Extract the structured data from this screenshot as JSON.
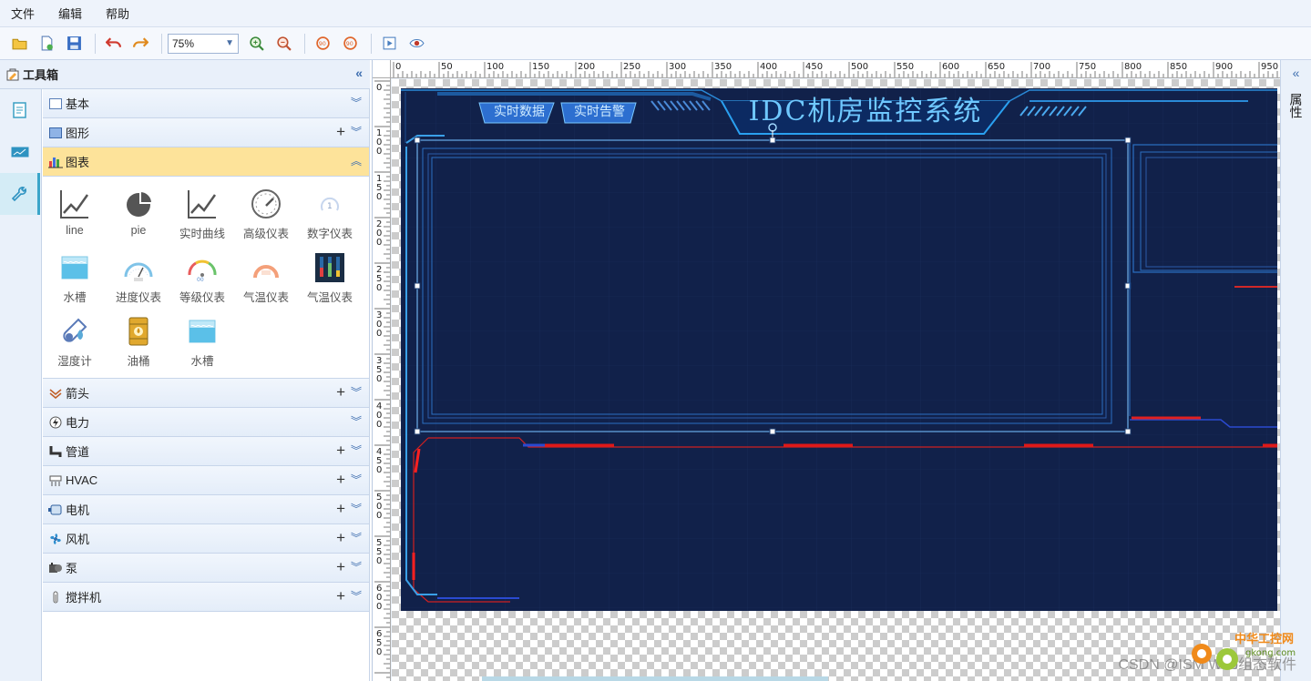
{
  "menu": [
    "文件",
    "编辑",
    "帮助"
  ],
  "toolbar": {
    "zoom": "75%",
    "icons": [
      "open-folder-icon",
      "new-file-icon",
      "save-icon",
      "undo-icon",
      "redo-icon",
      "zoom-in-icon",
      "zoom-out-icon",
      "rotate-left-icon",
      "rotate-right-icon",
      "preview-icon",
      "eye-icon"
    ]
  },
  "toolbox": {
    "title": "工具箱"
  },
  "categories": [
    {
      "label": "基本",
      "plus": false
    },
    {
      "label": "图形",
      "plus": true
    },
    {
      "label": "图表",
      "plus": false,
      "open": true
    }
  ],
  "chart_items": [
    "line",
    "pie",
    "实时曲线",
    "高级仪表",
    "数字仪表",
    "水槽",
    "进度仪表",
    "等级仪表",
    "气温仪表",
    "气温仪表",
    "湿度计",
    "油桶",
    "水槽"
  ],
  "categories_after": [
    {
      "label": "箭头",
      "plus": true
    },
    {
      "label": "电力",
      "plus": false
    },
    {
      "label": "管道",
      "plus": true
    },
    {
      "label": "HVAC",
      "plus": true
    },
    {
      "label": "电机",
      "plus": true
    },
    {
      "label": "风机",
      "plus": true
    },
    {
      "label": "泵",
      "plus": true
    },
    {
      "label": "搅拌机",
      "plus": true
    }
  ],
  "canvas": {
    "title": "IDC机房监控系统",
    "btn1": "实时数据",
    "btn2": "实时告警",
    "ruler_top": [
      "0",
      "50",
      "100",
      "150",
      "200",
      "250",
      "300",
      "350",
      "400",
      "450",
      "500",
      "550",
      "600",
      "650",
      "700",
      "750",
      "800",
      "850",
      "900",
      "950"
    ],
    "ruler_left": [
      "0",
      "1\n0\n0",
      "1\n5\n0",
      "2\n0\n0",
      "2\n5\n0",
      "3\n0\n0",
      "3\n5\n0",
      "4\n0\n0",
      "4\n5\n0",
      "5\n0\n0",
      "5\n5\n0",
      "6\n0\n0",
      "6\n5\n0"
    ]
  },
  "props": {
    "title": "属性"
  },
  "watermark": "CSDN @ISM Web组态软件",
  "logo": {
    "line1": "中华工控网",
    "line2": "gkong.com"
  }
}
